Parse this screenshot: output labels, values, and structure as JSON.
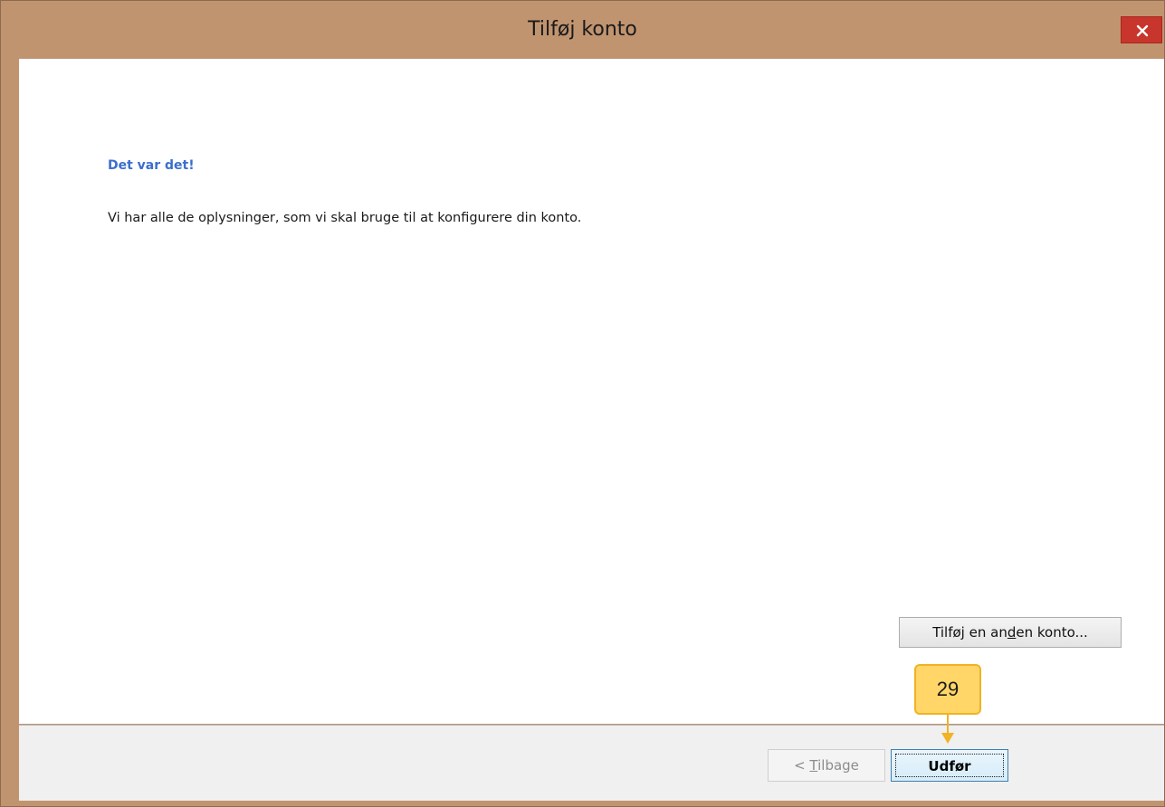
{
  "window": {
    "title": "Tilføj konto"
  },
  "content": {
    "heading": "Det var det!",
    "message": "Vi har alle de oplysninger, som vi skal bruge til at konfigurere din konto."
  },
  "buttons": {
    "add_account_pre": "Tilføj en an",
    "add_account_accel": "d",
    "add_account_post": "en konto...",
    "back_pre": "< ",
    "back_accel": "T",
    "back_post": "ilbage",
    "finish": "Udfør"
  },
  "annotation": {
    "step_number": "29"
  },
  "colors": {
    "titlebar": "#c19470",
    "close_button": "#c7352c",
    "heading": "#3b6fcc",
    "callout": "#ffd667",
    "callout_border": "#f0b323"
  }
}
